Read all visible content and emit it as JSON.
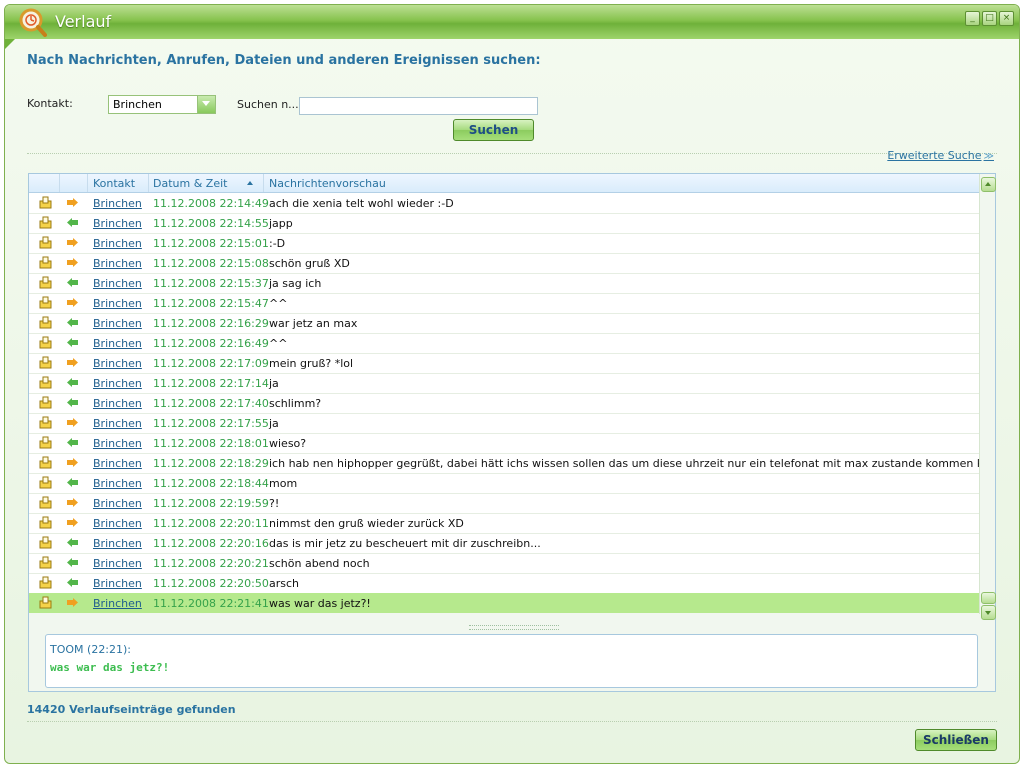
{
  "window": {
    "title": "Verlauf"
  },
  "heading": "Nach Nachrichten, Anrufen, Dateien und anderen Ereignissen suchen:",
  "search": {
    "contact_label": "Kontakt:",
    "contact_value": "Brinchen",
    "search_label": "Suchen n...",
    "search_value": "",
    "search_button": "Suchen",
    "advanced_link": "Erweiterte Suche"
  },
  "table": {
    "headers": {
      "contact": "Kontakt",
      "datetime": "Datum & Zeit",
      "preview": "Nachrichtenvorschau"
    },
    "rows": [
      {
        "dir": "out",
        "contact": "Brinchen",
        "datetime": "11.12.2008 22:14:49",
        "message": "ach die xenia telt wohl wieder :-D"
      },
      {
        "dir": "in",
        "contact": "Brinchen",
        "datetime": "11.12.2008 22:14:55",
        "message": "japp"
      },
      {
        "dir": "out",
        "contact": "Brinchen",
        "datetime": "11.12.2008 22:15:01",
        "message": ":-D"
      },
      {
        "dir": "out",
        "contact": "Brinchen",
        "datetime": "11.12.2008 22:15:08",
        "message": "schön gruß XD"
      },
      {
        "dir": "in",
        "contact": "Brinchen",
        "datetime": "11.12.2008 22:15:37",
        "message": "ja sag ich"
      },
      {
        "dir": "out",
        "contact": "Brinchen",
        "datetime": "11.12.2008 22:15:47",
        "message": "^^"
      },
      {
        "dir": "in",
        "contact": "Brinchen",
        "datetime": "11.12.2008 22:16:29",
        "message": "war jetz an max"
      },
      {
        "dir": "in",
        "contact": "Brinchen",
        "datetime": "11.12.2008 22:16:49",
        "message": "^^"
      },
      {
        "dir": "out",
        "contact": "Brinchen",
        "datetime": "11.12.2008 22:17:09",
        "message": "mein gruß? *lol"
      },
      {
        "dir": "in",
        "contact": "Brinchen",
        "datetime": "11.12.2008 22:17:14",
        "message": "ja"
      },
      {
        "dir": "in",
        "contact": "Brinchen",
        "datetime": "11.12.2008 22:17:40",
        "message": "schlimm?"
      },
      {
        "dir": "out",
        "contact": "Brinchen",
        "datetime": "11.12.2008 22:17:55",
        "message": "ja"
      },
      {
        "dir": "in",
        "contact": "Brinchen",
        "datetime": "11.12.2008 22:18:01",
        "message": "wieso?"
      },
      {
        "dir": "out",
        "contact": "Brinchen",
        "datetime": "11.12.2008 22:18:29",
        "message": "ich hab nen hiphopper gegrüßt, dabei hätt ichs wissen sollen das um diese uhrzeit nur ein telefonat mit max zustande kommen kann"
      },
      {
        "dir": "in",
        "contact": "Brinchen",
        "datetime": "11.12.2008 22:18:44",
        "message": "mom"
      },
      {
        "dir": "out",
        "contact": "Brinchen",
        "datetime": "11.12.2008 22:19:59",
        "message": "?!"
      },
      {
        "dir": "out",
        "contact": "Brinchen",
        "datetime": "11.12.2008 22:20:11",
        "message": "nimmst den gruß wieder zurück XD"
      },
      {
        "dir": "in",
        "contact": "Brinchen",
        "datetime": "11.12.2008 22:20:16",
        "message": "das is mir jetz zu bescheuert mit dir zuschreibn..."
      },
      {
        "dir": "in",
        "contact": "Brinchen",
        "datetime": "11.12.2008 22:20:21",
        "message": "schön abend noch"
      },
      {
        "dir": "in",
        "contact": "Brinchen",
        "datetime": "11.12.2008 22:20:50",
        "message": "arsch"
      },
      {
        "dir": "out",
        "contact": "Brinchen",
        "datetime": "11.12.2008 22:21:41",
        "message": "was war das jetz?!",
        "selected": true
      }
    ]
  },
  "preview": {
    "sender": "TOOM (22:21):",
    "message": "was war das jetz?!"
  },
  "status": "14420 Verlaufseinträge gefunden",
  "close_button": "Schließen",
  "colors": {
    "accent": "#2a73a1",
    "titlebar": "#86c24d",
    "selected_row": "#b6e98d",
    "incoming_arrow": "#52b64a",
    "outgoing_arrow": "#f0a020"
  }
}
